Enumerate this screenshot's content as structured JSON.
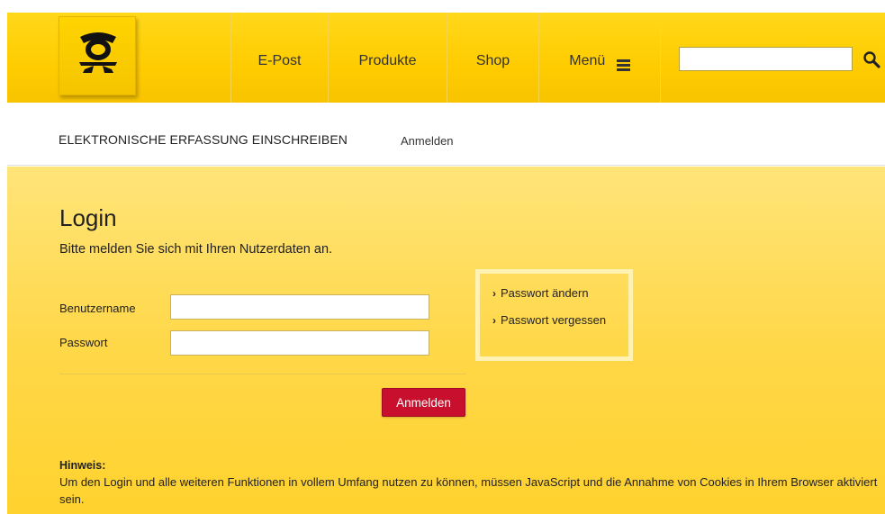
{
  "header": {
    "nav": [
      {
        "label": "E-Post"
      },
      {
        "label": "Produkte"
      },
      {
        "label": "Shop"
      },
      {
        "label": "Menü"
      }
    ],
    "search": {
      "value": "",
      "placeholder": ""
    },
    "logo_icon": "deutsche-post-horn-icon",
    "accent_color": "#ffcc00"
  },
  "breadcrumb": {
    "title": "ELEKTRONISCHE ERFASSUNG EINSCHREIBEN",
    "link": "Anmelden"
  },
  "login": {
    "title": "Login",
    "subtitle": "Bitte melden Sie sich mit Ihren Nutzerdaten an.",
    "username_label": "Benutzername",
    "password_label": "Passwort",
    "username_value": "",
    "password_value": "",
    "submit_label": "Anmelden",
    "submit_color": "#c8102e"
  },
  "password_links": {
    "change": "Passwort ändern",
    "forgot": "Passwort vergessen"
  },
  "hint": {
    "title": "Hinweis:",
    "text": "Um den Login und alle weiteren Funktionen in vollem Umfang nutzen zu können, müssen JavaScript und die Annahme von Cookies in Ihrem Browser aktiviert sein."
  }
}
